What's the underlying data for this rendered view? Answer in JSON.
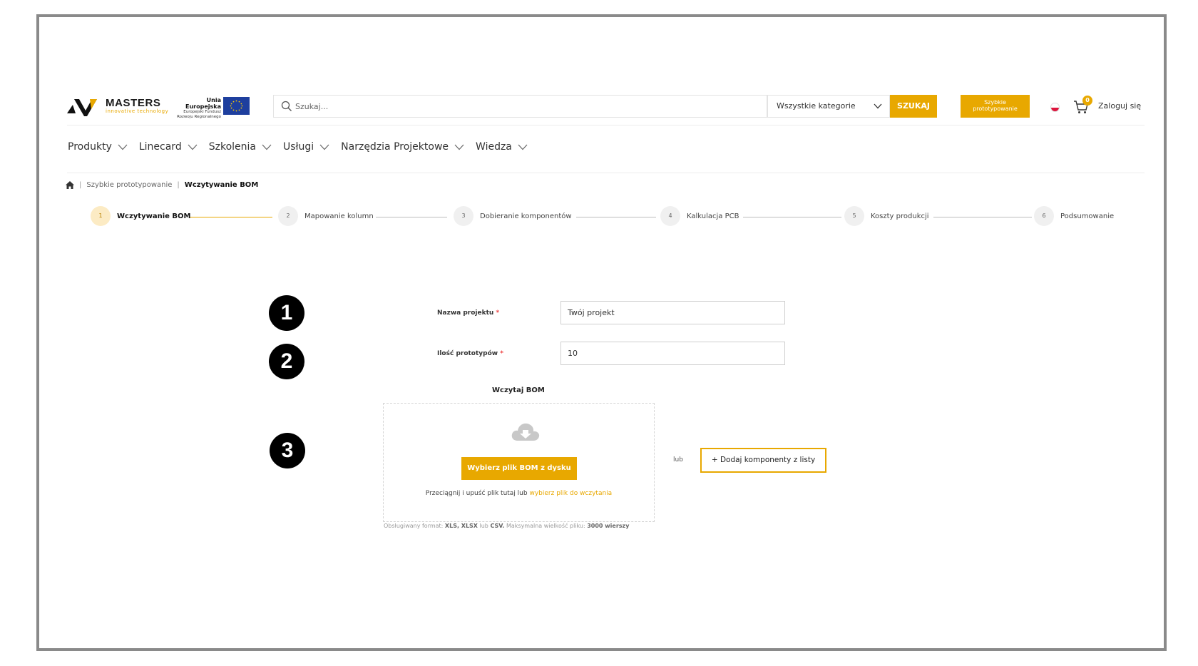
{
  "header": {
    "logo_text": "MASTERS",
    "logo_subtext": "innovative technology",
    "eu_title": "Unia Europejska",
    "eu_sub1": "Europejski Fundusz",
    "eu_sub2": "Rozwoju Regionalnego",
    "search_placeholder": "Szukaj...",
    "category_select": "Wszystkie kategorie",
    "search_button": "SZUKAJ",
    "quick_proto_button_line1": "Szybkie",
    "quick_proto_button_line2": "prototypowanie",
    "cart_count": "0",
    "login_label": "Zaloguj się"
  },
  "nav": {
    "items": [
      {
        "label": "Produkty"
      },
      {
        "label": "Linecard"
      },
      {
        "label": "Szkolenia"
      },
      {
        "label": "Usługi"
      },
      {
        "label": "Narzędzia Projektowe"
      },
      {
        "label": "Wiedza"
      }
    ]
  },
  "breadcrumb": {
    "parent": "Szybkie prototypowanie",
    "current": "Wczytywanie BOM"
  },
  "steps": [
    {
      "num": "1",
      "label": "Wczytywanie BOM",
      "active": true
    },
    {
      "num": "2",
      "label": "Mapowanie kolumn",
      "active": false
    },
    {
      "num": "3",
      "label": "Dobieranie komponentów",
      "active": false
    },
    {
      "num": "4",
      "label": "Kalkulacja PCB",
      "active": false
    },
    {
      "num": "5",
      "label": "Koszty produkcji",
      "active": false
    },
    {
      "num": "6",
      "label": "Podsumowanie",
      "active": false
    }
  ],
  "annotations": [
    "1",
    "2",
    "3"
  ],
  "form": {
    "project_name_label": "Nazwa projektu",
    "project_name_value": "Twój projekt",
    "prototypes_label": "Ilość prototypów",
    "prototypes_value": "10",
    "required_mark": "*",
    "upload_title": "Wczytaj BOM",
    "upload_button": "Wybierz plik BOM z dysku",
    "drop_hint": "Przeciągnij i upuść plik tutaj lub",
    "drop_hint_link": "wybierz plik do wczytania",
    "format_prefix": "Obsługiwany format:",
    "format_types": "XLS, XLSX",
    "format_or": "lub",
    "format_csv": "CSV.",
    "max_size_prefix": "Maksymalna wielkość pliku:",
    "max_size_value": "3000 wierszy",
    "or_text": "lub",
    "add_from_list_button": "+ Dodaj komponenty z listy"
  },
  "colors": {
    "accent": "#e8a800",
    "eu_blue": "#1e3f9e",
    "annotation_badge": "#000000"
  }
}
